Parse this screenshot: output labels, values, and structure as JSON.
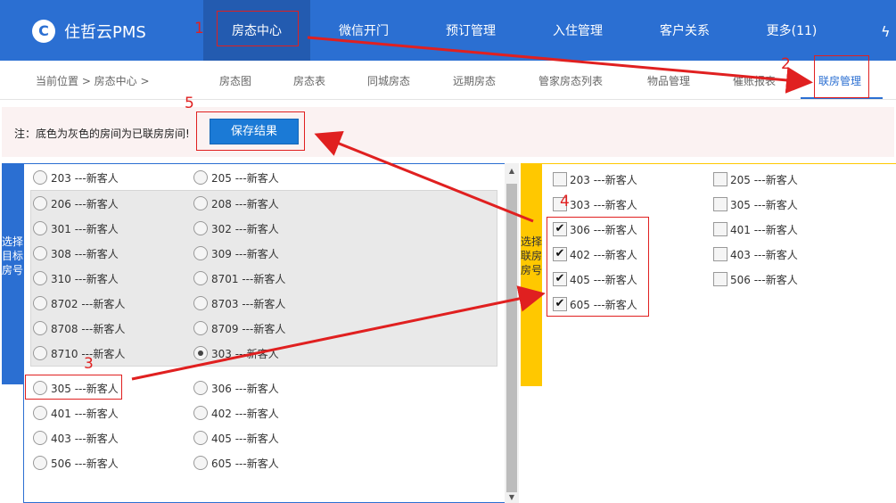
{
  "logo": {
    "text": "住哲云PMS",
    "mark": "C"
  },
  "nav": {
    "items": [
      "房态中心",
      "微信开门",
      "预订管理",
      "入住管理",
      "客户关系",
      "更多(11)"
    ],
    "bolt_icon": "ϟ"
  },
  "breadcrumb": "当前位置 > 房态中心 >",
  "subtabs": [
    "房态图",
    "房态表",
    "同城房态",
    "远期房态",
    "管家房态列表",
    "物品管理",
    "催账报表",
    "联房管理"
  ],
  "notice": {
    "text": "注：底色为灰色的房间为已联房房间!",
    "save_label": "保存结果"
  },
  "left": {
    "tag": "选择目标房号",
    "rooms": [
      {
        "label": "203 ---新客人",
        "checked": false
      },
      {
        "label": "205 ---新客人",
        "checked": false
      },
      {
        "label": "206 ---新客人",
        "checked": false
      },
      {
        "label": "208 ---新客人",
        "checked": false
      },
      {
        "label": "301 ---新客人",
        "checked": false
      },
      {
        "label": "302 ---新客人",
        "checked": false
      },
      {
        "label": "308 ---新客人",
        "checked": false
      },
      {
        "label": "309 ---新客人",
        "checked": false
      },
      {
        "label": "310 ---新客人",
        "checked": false
      },
      {
        "label": "8701 ---新客人",
        "checked": false
      },
      {
        "label": "8702 ---新客人",
        "checked": false
      },
      {
        "label": "8703 ---新客人",
        "checked": false
      },
      {
        "label": "8708 ---新客人",
        "checked": false
      },
      {
        "label": "8709 ---新客人",
        "checked": false
      },
      {
        "label": "8710 ---新客人",
        "checked": false
      },
      {
        "label": "303 ---新客人",
        "checked": true
      },
      {
        "label": "305 ---新客人",
        "checked": false
      },
      {
        "label": "306 ---新客人",
        "checked": false
      },
      {
        "label": "401 ---新客人",
        "checked": false
      },
      {
        "label": "402 ---新客人",
        "checked": false
      },
      {
        "label": "403 ---新客人",
        "checked": false
      },
      {
        "label": "405 ---新客人",
        "checked": false
      },
      {
        "label": "506 ---新客人",
        "checked": false
      },
      {
        "label": "605 ---新客人",
        "checked": false
      }
    ]
  },
  "right": {
    "tag": "选择联房房号",
    "rooms": [
      {
        "label": "203 ---新客人",
        "checked": false
      },
      {
        "label": "205 ---新客人",
        "checked": false
      },
      {
        "label": "303 ---新客人",
        "checked": false
      },
      {
        "label": "305 ---新客人",
        "checked": false
      },
      {
        "label": "306 ---新客人",
        "checked": true
      },
      {
        "label": "401 ---新客人",
        "checked": false
      },
      {
        "label": "402 ---新客人",
        "checked": true
      },
      {
        "label": "403 ---新客人",
        "checked": false
      },
      {
        "label": "405 ---新客人",
        "checked": true
      },
      {
        "label": "506 ---新客人",
        "checked": false
      },
      {
        "label": "605 ---新客人",
        "checked": true
      }
    ]
  },
  "annotations": [
    "1",
    "2",
    "3",
    "4",
    "5"
  ],
  "colors": {
    "nav": "#2b6fd2",
    "accent": "#e02020",
    "yellow": "#ffc800"
  }
}
